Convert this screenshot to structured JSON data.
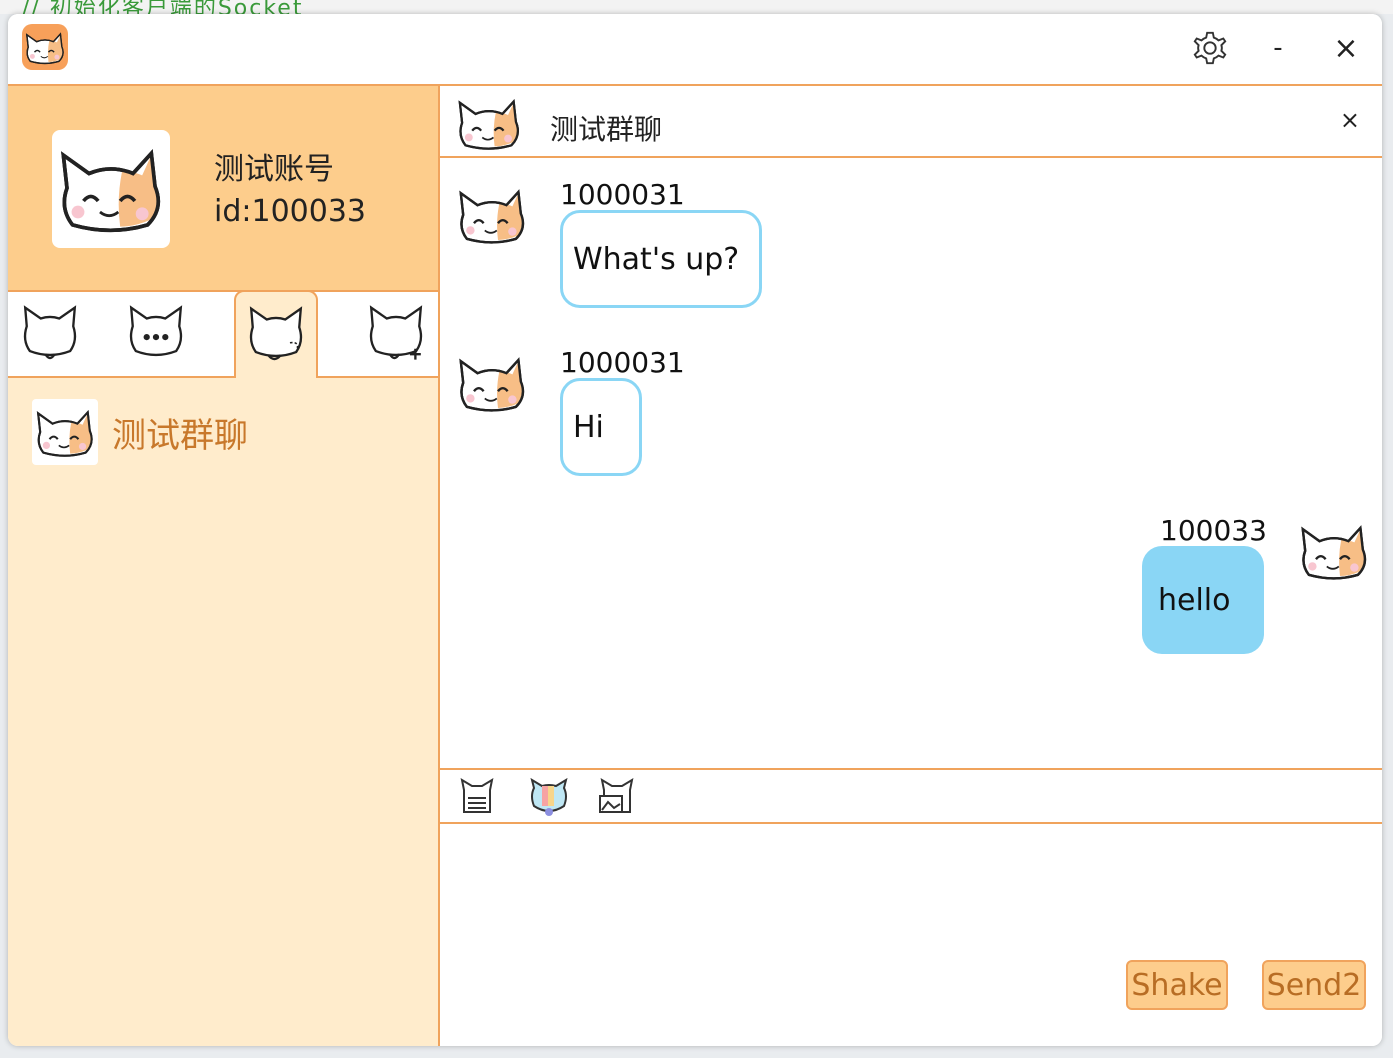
{
  "background": {
    "text": "// 初始化客户端的Socket"
  },
  "window": {
    "controls": {
      "settings_icon": "gear-icon",
      "minimize_label": "-",
      "close_label": "×"
    }
  },
  "profile": {
    "name": "测试账号",
    "id_text": "id:100033"
  },
  "tabs": [
    {
      "icon": "cat-icon"
    },
    {
      "icon": "cat-chat-icon"
    },
    {
      "icon": "cat-group-icon",
      "active": true
    },
    {
      "icon": "cat-add-icon"
    }
  ],
  "groups": [
    {
      "name": "测试群聊"
    }
  ],
  "chat": {
    "title": "测试群聊",
    "close_label": "×",
    "messages": [
      {
        "sender": "1000031",
        "text": "What's up?",
        "side": "left"
      },
      {
        "sender": "1000031",
        "text": "Hi",
        "side": "left"
      },
      {
        "sender": "100033",
        "text": "hello",
        "side": "right"
      }
    ],
    "tools": [
      {
        "icon": "file-icon"
      },
      {
        "icon": "emoji-icon"
      },
      {
        "icon": "image-icon"
      }
    ],
    "input_value": "",
    "buttons": {
      "shake": "Shake",
      "send": "Send2"
    }
  },
  "colors": {
    "accent_border": "#f0a35c",
    "profile_bg": "#fdcd8c",
    "sidebar_bg": "#ffeccc",
    "bubble_blue": "#8ad6f5",
    "group_text": "#c8782b"
  }
}
